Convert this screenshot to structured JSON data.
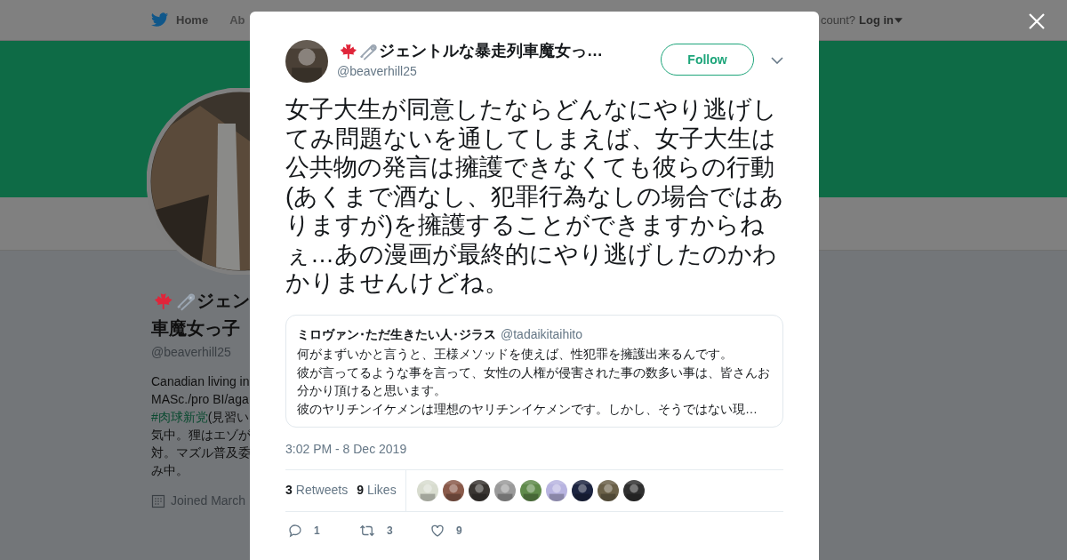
{
  "nav": {
    "items": [
      {
        "label": "Home",
        "selected": true
      },
      {
        "label": "Ab",
        "selected": false
      }
    ],
    "account_prompt": "count?",
    "login": "Log in"
  },
  "profile": {
    "name_line_1": "ジェン",
    "name_line_2": "車魔女っ子",
    "handle": "@beaverhill25",
    "bio_lines": [
      {
        "text": "Canadian living in",
        "kind": "plain"
      },
      {
        "text": "MASc./pro BI/aga",
        "kind": "plain"
      },
      {
        "text": "#肉球新党",
        "kind": "hashtag",
        "rest": "(見習い"
      },
      {
        "text": "気中。狸はエゾが",
        "kind": "plain"
      },
      {
        "text": "対。マズル普及委",
        "kind": "plain"
      },
      {
        "text": "み中。",
        "kind": "plain"
      }
    ],
    "joined": "Joined March"
  },
  "tweet": {
    "author": "ジェントルな暴走列車魔女っ…",
    "handle": "@beaverhill25",
    "follow": "Follow",
    "text": "女子大生が同意したならどんなにやり逃げしてみ問題ないを通してしまえば、女子大生は公共物の発言は擁護できなくても彼らの行動(あくまで酒なし、犯罪行為なしの場合ではありますが)を擁護することができますからねぇ…あの漫画が最終的にやり逃げしたのかわかりませんけどね。",
    "quote": {
      "author": "ミロヴァン･ただ生きたい人･ジラス",
      "handle": "@tadaikitaihito",
      "lines": [
        "何がまずいかと言うと、王様メソッドを使えば、性犯罪を擁護出来るんです。",
        "彼が言ってるような事を言って、女性の人権が侵害された事の数多い事は、皆さんお分かり頂けると思います。",
        "彼のヤリチンイケメンは理想のヤリチンイケメンです。しかし、そうではない現…"
      ]
    },
    "timestamp": "3:02 PM - 8 Dec 2019",
    "stats": [
      {
        "count": "3",
        "label": "Retweets"
      },
      {
        "count": "9",
        "label": "Likes"
      }
    ],
    "likers": [
      {
        "color": "#d8dccf"
      },
      {
        "color": "#8a5a4a"
      },
      {
        "color": "#3a3632"
      },
      {
        "color": "#9a9a9a"
      },
      {
        "color": "#5f8a4a"
      },
      {
        "color": "#b8b4e0"
      },
      {
        "color": "#1c2440"
      },
      {
        "color": "#6a6048"
      },
      {
        "color": "#2f2f2f"
      }
    ],
    "actions": [
      {
        "kind": "reply",
        "count": "1"
      },
      {
        "kind": "retweet",
        "count": "3"
      },
      {
        "kind": "like",
        "count": "9"
      }
    ]
  }
}
